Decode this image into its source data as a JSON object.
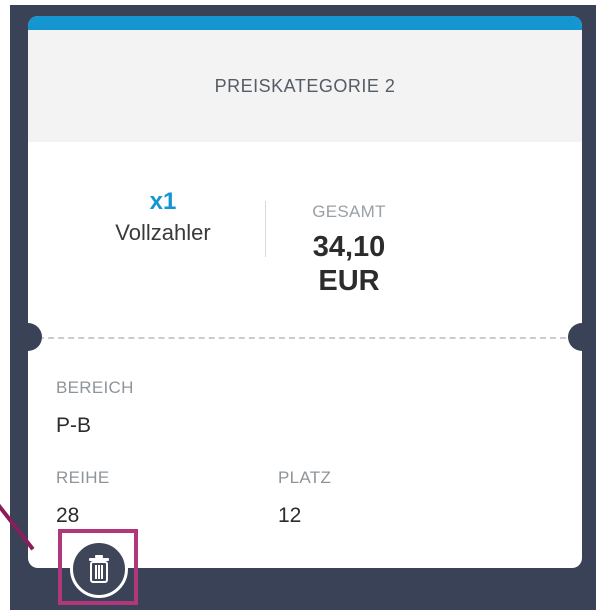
{
  "card": {
    "category": "PREISKATEGORIE 2",
    "quantity": "x1",
    "ticket_type": "Vollzahler",
    "total_label": "GESAMT",
    "total_amount": "34,10",
    "total_currency": "EUR"
  },
  "seat": {
    "area_label": "BEREICH",
    "area_value": "P-B",
    "row_label": "REIHE",
    "row_value": "28",
    "seat_label": "PLATZ",
    "seat_value": "12"
  },
  "actions": {
    "delete_icon": "trash-icon"
  },
  "colors": {
    "accent": "#1596d1",
    "frame": "#3a4257",
    "highlight": "#b0377a"
  }
}
